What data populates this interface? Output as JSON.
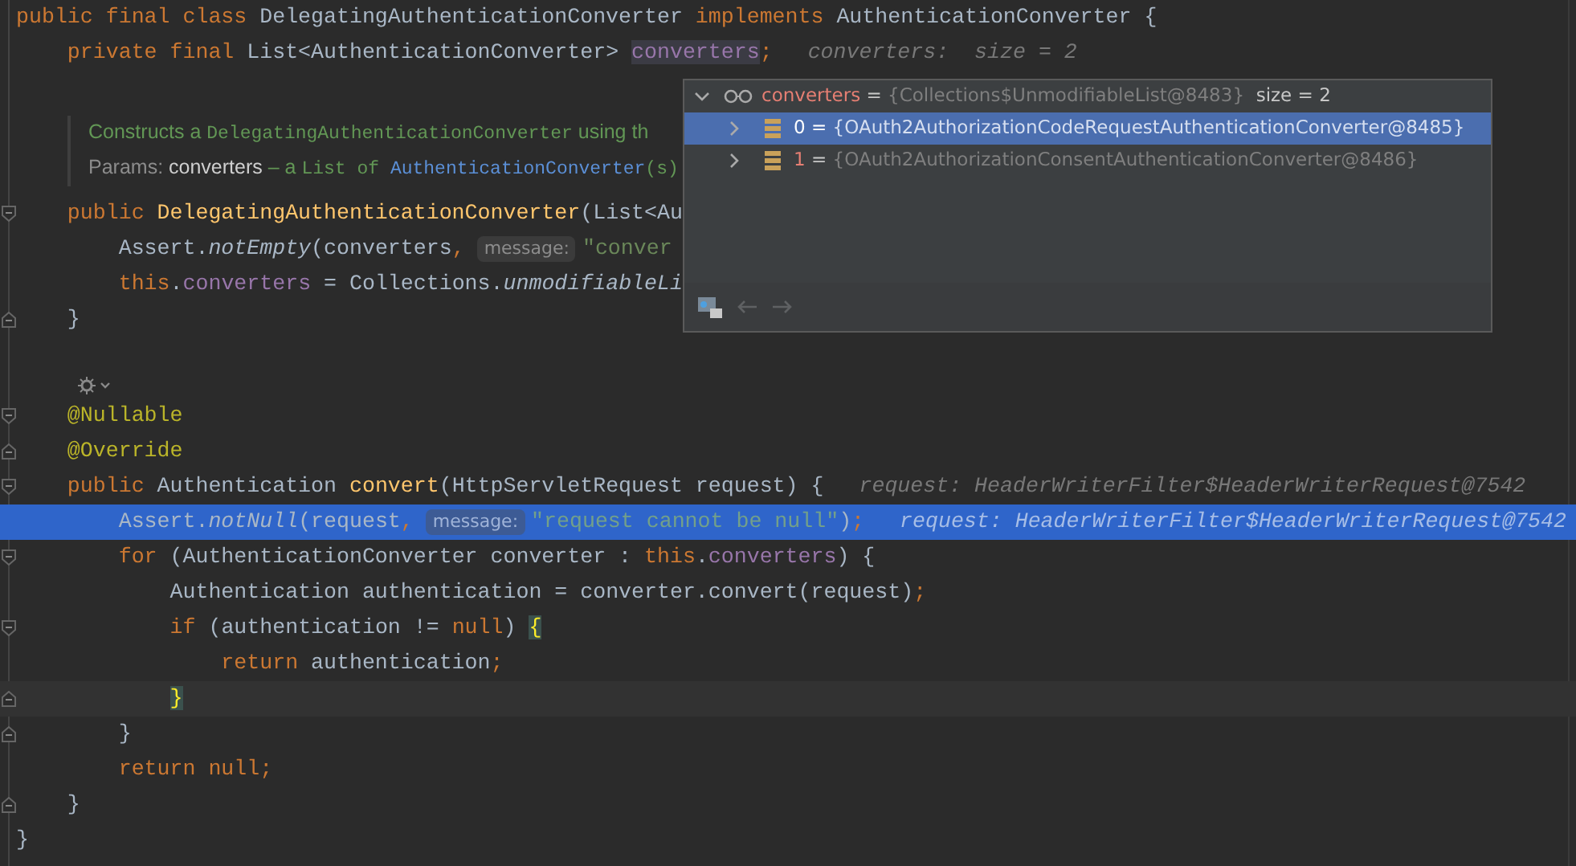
{
  "editor": {
    "lines": [
      {
        "kind": "code",
        "tokens": [
          {
            "kind": "keyword",
            "text": "public final class "
          },
          {
            "kind": "plain",
            "text": "DelegatingAuthenticationConverter "
          },
          {
            "kind": "keyword",
            "text": "implements "
          },
          {
            "kind": "plain",
            "text": "AuthenticationConverter {"
          }
        ]
      },
      {
        "kind": "code",
        "tokens": [
          {
            "kind": "keyword",
            "text": "    private final "
          },
          {
            "kind": "plain",
            "text": "List<AuthenticationConverter> "
          },
          {
            "kind": "field_hl",
            "text": "converters"
          },
          {
            "kind": "keyword",
            "text": ";"
          },
          {
            "kind": "inline_value",
            "text": "converters:  size = 2"
          }
        ]
      },
      {
        "kind": "blank"
      },
      {
        "kind": "doc",
        "tokens": [
          {
            "kind": "doc_text",
            "text": "Constructs a "
          },
          {
            "kind": "doc_code",
            "text": "DelegatingAuthenticationConverter"
          },
          {
            "kind": "doc_text",
            "text": " using th"
          }
        ]
      },
      {
        "kind": "doc",
        "tokens": [
          {
            "kind": "doc_label",
            "text": "Params: "
          },
          {
            "kind": "doc_param",
            "text": "converters"
          },
          {
            "kind": "doc_text",
            "text": " – a "
          },
          {
            "kind": "doc_code",
            "text": "List of "
          },
          {
            "kind": "doc_link",
            "text": "AuthenticationConverter"
          },
          {
            "kind": "doc_code",
            "text": "(s)"
          }
        ]
      },
      {
        "kind": "code",
        "fold_open": true,
        "tokens": [
          {
            "kind": "keyword",
            "text": "    public "
          },
          {
            "kind": "method",
            "text": "DelegatingAuthenticationConverter"
          },
          {
            "kind": "plain",
            "text": "(List<Au"
          }
        ]
      },
      {
        "kind": "code",
        "tokens": [
          {
            "kind": "plain",
            "text": "        Assert."
          },
          {
            "kind": "static",
            "text": "notEmpty"
          },
          {
            "kind": "plain",
            "text": "(converters"
          },
          {
            "kind": "keyword",
            "text": ","
          },
          {
            "kind": "param_hint",
            "text": "message:"
          },
          {
            "kind": "string",
            "text": "\"conver"
          }
        ]
      },
      {
        "kind": "code",
        "tokens": [
          {
            "kind": "keyword",
            "text": "        this"
          },
          {
            "kind": "plain",
            "text": "."
          },
          {
            "kind": "field",
            "text": "converters"
          },
          {
            "kind": "plain",
            "text": " = Collections."
          },
          {
            "kind": "static",
            "text": "unmodifiableLi"
          }
        ]
      },
      {
        "kind": "code",
        "fold_close": true,
        "tokens": [
          {
            "kind": "plain",
            "text": "    }"
          }
        ]
      },
      {
        "kind": "blank"
      },
      {
        "kind": "marker"
      },
      {
        "kind": "code",
        "fold_open": true,
        "tokens": [
          {
            "kind": "annotation",
            "text": "    @Nullable"
          }
        ]
      },
      {
        "kind": "code",
        "fold_close": true,
        "tokens": [
          {
            "kind": "annotation",
            "text": "    @Override"
          }
        ]
      },
      {
        "kind": "code",
        "fold_open": true,
        "tokens": [
          {
            "kind": "keyword",
            "text": "    public "
          },
          {
            "kind": "plain",
            "text": "Authentication "
          },
          {
            "kind": "method",
            "text": "convert"
          },
          {
            "kind": "plain",
            "text": "(HttpServletRequest request) {"
          },
          {
            "kind": "inline_value",
            "text": "request: HeaderWriterFilter$HeaderWriterRequest@7542"
          }
        ]
      },
      {
        "kind": "code",
        "execution_point": true,
        "tokens": [
          {
            "kind": "plain",
            "text": "        Assert."
          },
          {
            "kind": "static",
            "text": "notNull"
          },
          {
            "kind": "plain",
            "text": "(request"
          },
          {
            "kind": "keyword",
            "text": ","
          },
          {
            "kind": "param_hint",
            "text": "message:"
          },
          {
            "kind": "string",
            "text": "\"request cannot be null\""
          },
          {
            "kind": "plain",
            "text": ")"
          },
          {
            "kind": "keyword",
            "text": ";"
          },
          {
            "kind": "inline_value",
            "text": "request: HeaderWriterFilter$HeaderWriterRequest@7542"
          }
        ]
      },
      {
        "kind": "code",
        "fold_open": true,
        "tokens": [
          {
            "kind": "keyword",
            "text": "        for "
          },
          {
            "kind": "plain",
            "text": "(AuthenticationConverter converter : "
          },
          {
            "kind": "keyword",
            "text": "this"
          },
          {
            "kind": "plain",
            "text": "."
          },
          {
            "kind": "field",
            "text": "converters"
          },
          {
            "kind": "plain",
            "text": ") {"
          }
        ]
      },
      {
        "kind": "code",
        "tokens": [
          {
            "kind": "plain",
            "text": "            Authentication authentication = converter.convert(request)"
          },
          {
            "kind": "keyword",
            "text": ";"
          }
        ]
      },
      {
        "kind": "code",
        "fold_open": true,
        "tokens": [
          {
            "kind": "keyword",
            "text": "            if "
          },
          {
            "kind": "plain",
            "text": "(authentication != "
          },
          {
            "kind": "keyword",
            "text": "null"
          },
          {
            "kind": "plain",
            "text": ") "
          },
          {
            "kind": "brace_match",
            "text": "{"
          }
        ]
      },
      {
        "kind": "code",
        "tokens": [
          {
            "kind": "keyword",
            "text": "                return "
          },
          {
            "kind": "plain",
            "text": "authentication"
          },
          {
            "kind": "keyword",
            "text": ";"
          }
        ]
      },
      {
        "kind": "code",
        "fold_close": true,
        "current_line": true,
        "tokens": [
          {
            "kind": "brace_match",
            "text": "            }"
          }
        ]
      },
      {
        "kind": "code",
        "fold_close": true,
        "tokens": [
          {
            "kind": "plain",
            "text": "        }"
          }
        ]
      },
      {
        "kind": "code",
        "tokens": [
          {
            "kind": "keyword",
            "text": "        return null;"
          }
        ]
      },
      {
        "kind": "code",
        "fold_close": true,
        "tokens": [
          {
            "kind": "plain",
            "text": "    }"
          }
        ]
      },
      {
        "kind": "code",
        "tokens": [
          {
            "kind": "plain",
            "text": "}"
          }
        ]
      }
    ]
  },
  "debug_popup": {
    "root": {
      "expanded": true,
      "name": "converters",
      "equals": " = ",
      "value": "{Collections$UnmodifiableList@8483}",
      "extra": "size = 2"
    },
    "children": [
      {
        "index": "0",
        "equals": " = ",
        "value": "{OAuth2AuthorizationCodeRequestAuthenticationConverter@8485}",
        "selected": true,
        "expanded": false
      },
      {
        "index": "1",
        "equals": " = ",
        "value": "{OAuth2AuthorizationConsentAuthenticationConverter@8486}",
        "selected": false,
        "expanded": false
      }
    ]
  }
}
